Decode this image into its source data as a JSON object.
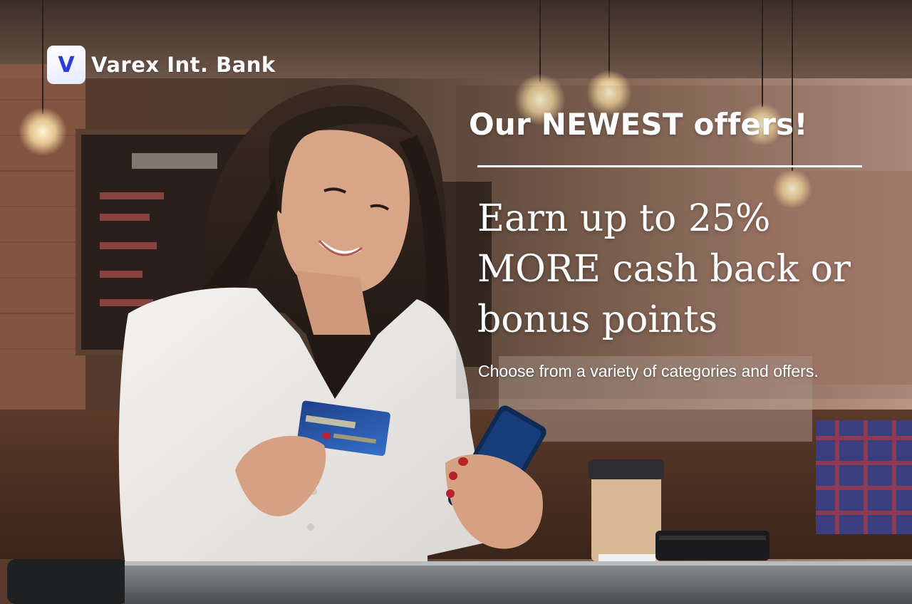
{
  "brand": {
    "logo_letter": "V",
    "name": "Varex Int. Bank",
    "accent": "#2b3bd8"
  },
  "banner": {
    "headline": "Our NEWEST offers!",
    "offer": "Earn up to 25% MORE cash back or bonus points",
    "subtext": "Choose from a variety of categories and offers."
  },
  "colors": {
    "text": "#ffffff",
    "background": "#2a2220"
  }
}
